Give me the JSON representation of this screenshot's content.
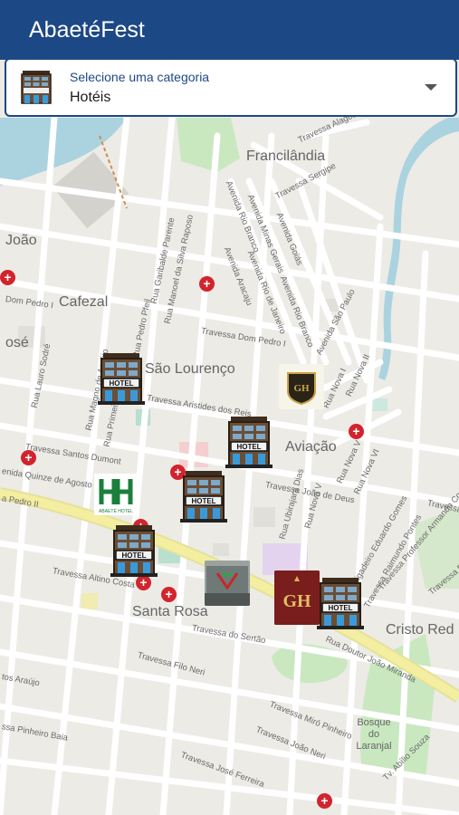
{
  "app": {
    "title": "AbaetéFest"
  },
  "category_selector": {
    "caption": "Selecione uma categoria",
    "value": "Hotéis",
    "icon": "hotel-building-icon"
  },
  "map": {
    "colors": {
      "land": "#ecebe6",
      "road": "#ffffff",
      "main_road": "#f3eea0",
      "water": "#aad3df",
      "park": "#c9e8c0",
      "hospital": "#d3232d"
    },
    "places": [
      {
        "id": "francilandia",
        "label": "Francilândia"
      },
      {
        "id": "joao",
        "label": "João"
      },
      {
        "id": "cafezal",
        "label": "Cafezal"
      },
      {
        "id": "se",
        "label": "osé"
      },
      {
        "id": "sao-lourenco",
        "label": "São Lourenço"
      },
      {
        "id": "aviacao",
        "label": "Aviação"
      },
      {
        "id": "santa-rosa",
        "label": "Santa Rosa"
      },
      {
        "id": "cristo-rei",
        "label": "Cristo Red"
      },
      {
        "id": "bosque",
        "label": "Bosque do Laranjal"
      }
    ],
    "streets": [
      {
        "id": "travessa-alagoas",
        "label": "Travessa Alagoas"
      },
      {
        "id": "travessa-sergipe",
        "label": "Travessa Sergipe"
      },
      {
        "id": "av-rio-branco",
        "label": "Avenida Rio Branco"
      },
      {
        "id": "av-minas-gerais",
        "label": "Avenida Minas Gerais"
      },
      {
        "id": "av-goias",
        "label": "Avenida Goiás"
      },
      {
        "id": "av-rio-de-janeiro",
        "label": "Avenida Rio de Janeiro"
      },
      {
        "id": "av-aracaju",
        "label": "Avenida Aracaju"
      },
      {
        "id": "av-rio-branco-2",
        "label": "Avenida Rio Branco"
      },
      {
        "id": "av-sao-paulo",
        "label": "Avenida São Paulo"
      },
      {
        "id": "rua-garibalde",
        "label": "Rua Garibalde Parente"
      },
      {
        "id": "rua-manoel",
        "label": "Rua Manoel da Silva Raposo"
      },
      {
        "id": "rua-pedro-pfeil",
        "label": "Rua Pedro Pfeil"
      },
      {
        "id": "dom-pedro-i-short",
        "label": "Dom Pedro I"
      },
      {
        "id": "travessa-dom-pedro-i",
        "label": "Travessa Dom Pedro I"
      },
      {
        "id": "rua-lauro-sodre",
        "label": "Rua Lauro Sodré"
      },
      {
        "id": "rua-magno",
        "label": "Rua Magno de Araújo"
      },
      {
        "id": "rua-primeiro",
        "label": "Rua Primeiro"
      },
      {
        "id": "travessa-aristides",
        "label": "Travessa Aristides dos Reis"
      },
      {
        "id": "travessa-santos-dumont",
        "label": "Travessa Santos Dumont"
      },
      {
        "id": "quinze",
        "label": "enida Quinze de Agosto"
      },
      {
        "id": "pedro-ii",
        "label": "a Pedro II"
      },
      {
        "id": "travessa-joao-de-deus",
        "label": "Travessa João de Deus"
      },
      {
        "id": "rua-ubirajara",
        "label": "Rua Ubirajara Dias"
      },
      {
        "id": "rua-nova-v",
        "label": "Rua Nova V"
      },
      {
        "id": "rua-nova-v-2",
        "label": "Rua Nova V"
      },
      {
        "id": "rua-nova-i",
        "label": "Rua Nova I"
      },
      {
        "id": "rua-nova-ii",
        "label": "Rua Nova II"
      },
      {
        "id": "rua-nova-vi",
        "label": "Rua Nova VI"
      },
      {
        "id": "rua-brigadeiro",
        "label": "Rua Brigadeiro Eduardo Gomes"
      },
      {
        "id": "travessa-raimundo",
        "label": "Travessa Raimundo Pontes"
      },
      {
        "id": "travessa-professor",
        "label": "Travessa Professor Armando Costa Baia"
      },
      {
        "id": "travessa-right",
        "label": "Travessa"
      },
      {
        "id": "travessa-altino",
        "label": "Travessa Altino Costa"
      },
      {
        "id": "travessa-do-sertao",
        "label": "Travessa do Sertão"
      },
      {
        "id": "travessa-filo-neri",
        "label": "Travessa Filo Neri"
      },
      {
        "id": "rua-doutor-joao",
        "label": "Rua Doutor João Miranda"
      },
      {
        "id": "tos-araujo",
        "label": "tos Araújo"
      },
      {
        "id": "ssa-pinheiro",
        "label": "ssa Pinheiro Baia"
      },
      {
        "id": "travessa-miro",
        "label": "Travessa Miró Pinheiro"
      },
      {
        "id": "travessa-joao-neri",
        "label": "Travessa João Neri"
      },
      {
        "id": "travessa-jose-ferreira",
        "label": "Travessa José Ferreira"
      },
      {
        "id": "tv-abilio",
        "label": "Tv. Abílio Souza"
      },
      {
        "id": "travessa-p",
        "label": "Travessa Pi"
      }
    ],
    "hotels": [
      {
        "id": "hotel-1",
        "label": "HOTEL"
      },
      {
        "id": "hotel-2",
        "label": "HOTEL"
      },
      {
        "id": "hotel-3",
        "label": "HOTEL"
      },
      {
        "id": "hotel-4",
        "label": "HOTEL"
      },
      {
        "id": "hotel-5",
        "label": "HOTEL"
      }
    ],
    "logos": [
      {
        "id": "logo-gold",
        "label": "GH"
      },
      {
        "id": "logo-green",
        "label": "ABAETÉ HOTEL"
      },
      {
        "id": "logo-grand",
        "label": "GH"
      }
    ]
  }
}
